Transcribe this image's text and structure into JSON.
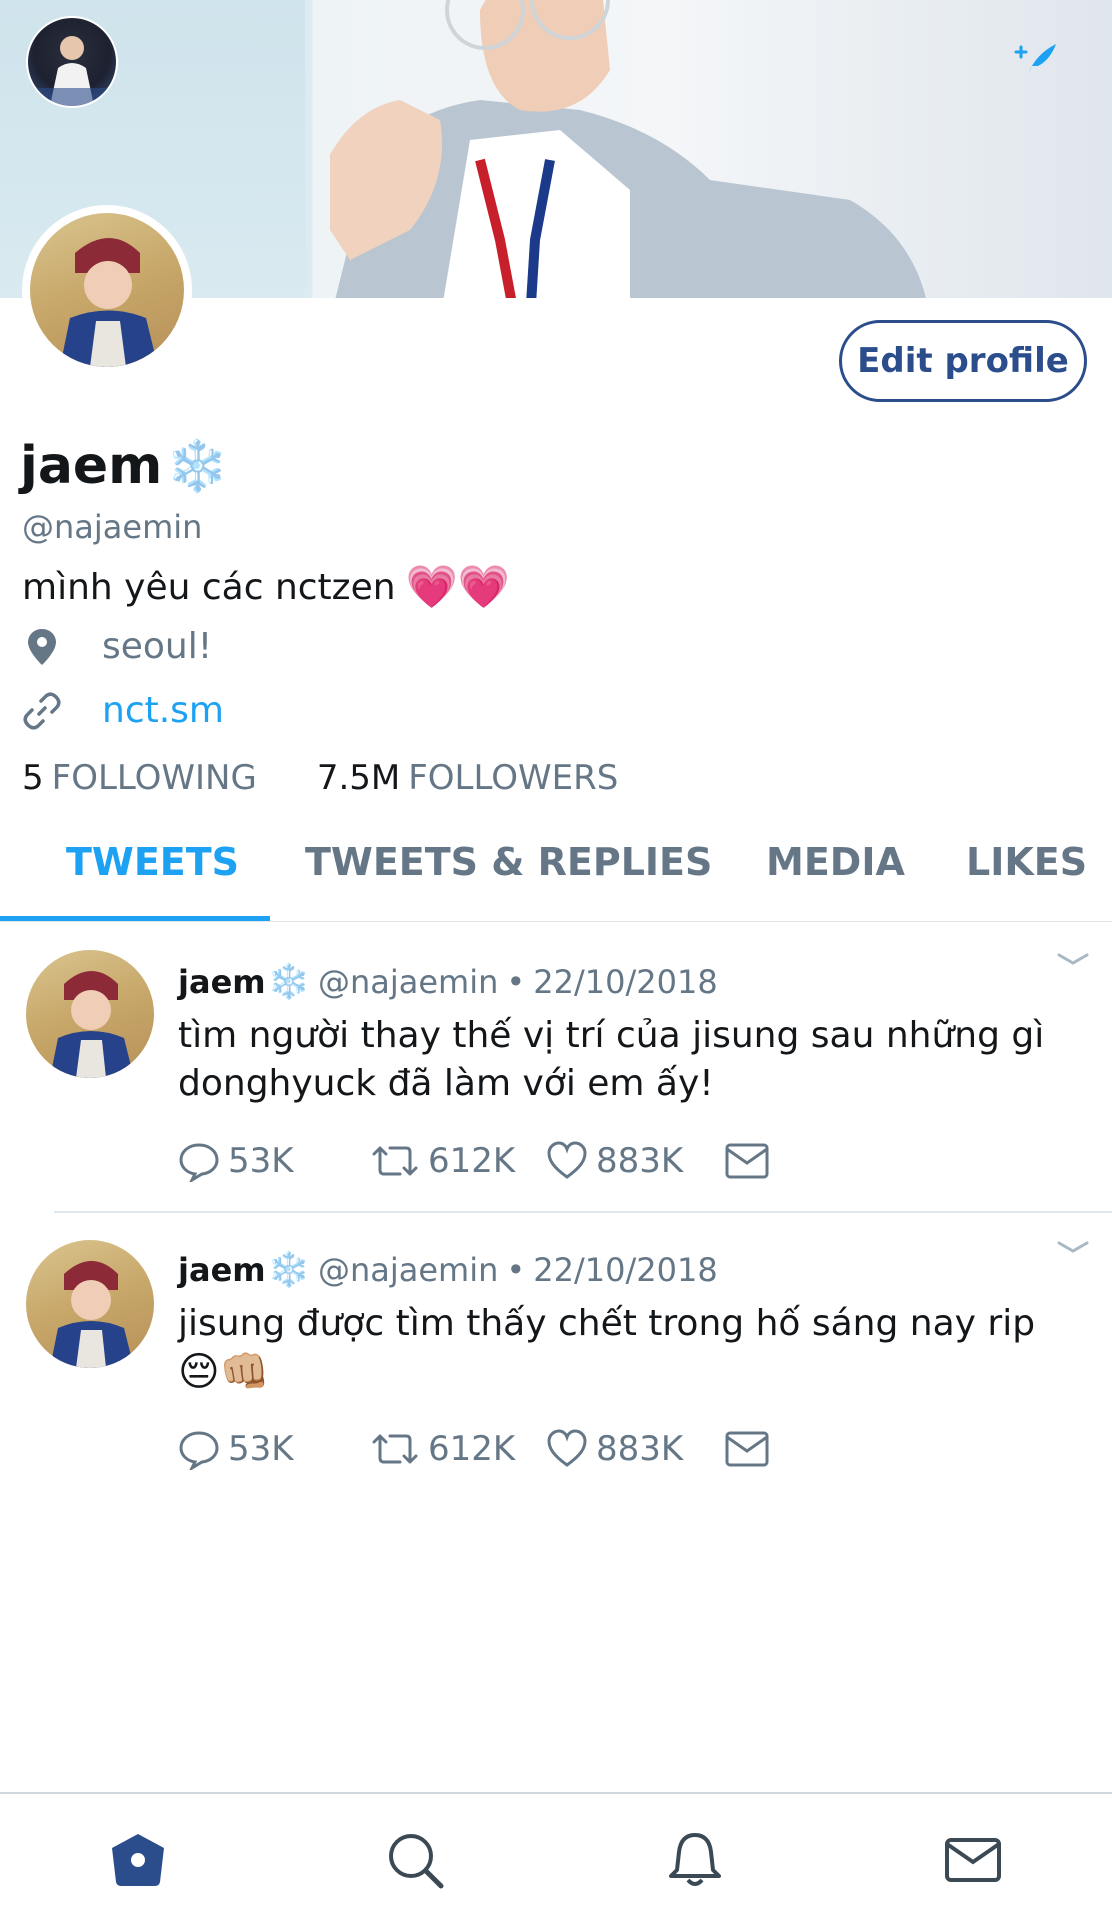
{
  "profile": {
    "name": "jaem",
    "name_emoji": "❄️",
    "handle": "@najaemin",
    "bio": "mình yêu các nctzen",
    "bio_emoji": "💗💗",
    "location": "seoul!",
    "link": "nct.sm",
    "following_count": "5",
    "following_label": "FOLLOWING",
    "followers_count": "7.5M",
    "followers_label": "FOLLOWERS",
    "edit_label": "Edit profile"
  },
  "tabs": [
    {
      "label": "TWEETS",
      "active": true
    },
    {
      "label": "TWEETS & REPLIES"
    },
    {
      "label": "MEDIA"
    },
    {
      "label": "LIKES"
    }
  ],
  "tweets": [
    {
      "name": "jaem",
      "name_emoji": "❄️",
      "handle": "@najaemin",
      "separator": "•",
      "date": "22/10/2018",
      "text_line1": "tìm người thay thế vị trí của jisung sau những gì",
      "text_line2": "donghyuck đã làm với em ấy!",
      "replies": "53K",
      "retweets": "612K",
      "likes": "883K"
    },
    {
      "name": "jaem",
      "name_emoji": "❄️",
      "handle": "@najaemin",
      "separator": "•",
      "date": "22/10/2018",
      "text_line1": "jisung được tìm thấy chết trong hố sáng nay rip",
      "text_line2": "😔👊🏼",
      "replies": "53K",
      "retweets": "612K",
      "likes": "883K"
    }
  ],
  "colors": {
    "accent": "#1da1f2",
    "edit_border": "#2b4d8c",
    "muted": "#657786",
    "nav_active": "#2b4d8c"
  },
  "icons": {
    "compose": "compose-tweet-icon",
    "location": "location-pin-icon",
    "link": "link-icon",
    "reply": "reply-icon",
    "retweet": "retweet-icon",
    "like": "heart-icon",
    "dm": "envelope-icon",
    "nav": [
      "home-icon",
      "search-icon",
      "bell-icon",
      "mail-icon"
    ]
  }
}
